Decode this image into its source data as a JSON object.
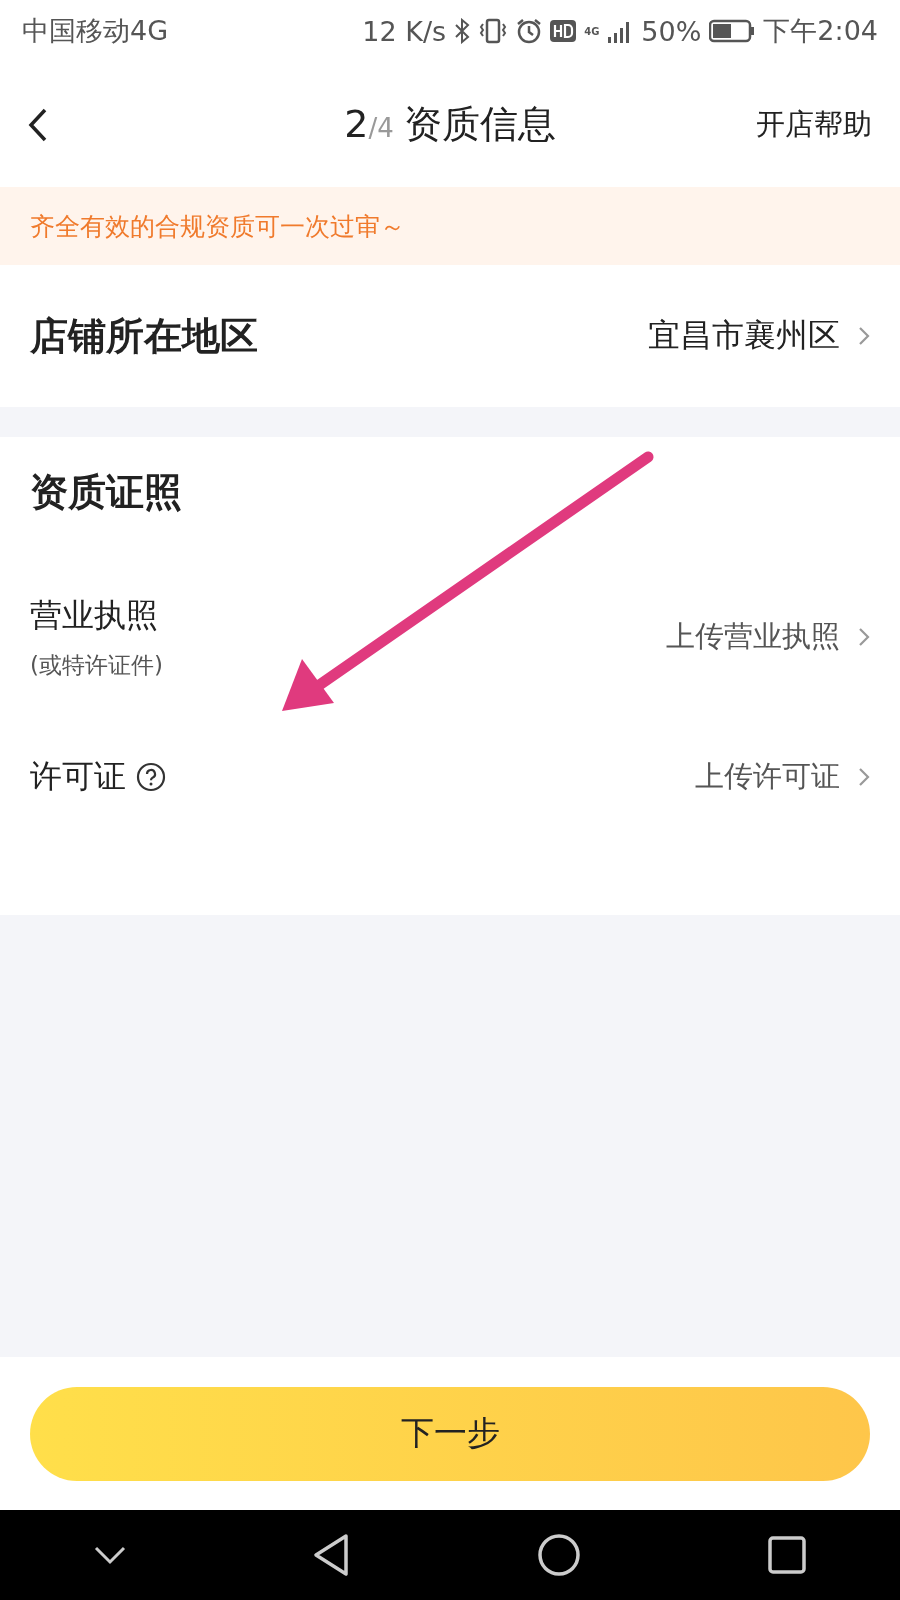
{
  "status_bar": {
    "carrier": "中国移动4G",
    "speed": "12 K/s",
    "network": "4G",
    "battery": "50%",
    "time": "下午2:04"
  },
  "header": {
    "step": "2",
    "total": "/4",
    "title": "资质信息",
    "help": "开店帮助"
  },
  "notice": "齐全有效的合规资质可一次过审～",
  "region": {
    "label": "店铺所在地区",
    "value": "宜昌市襄州区"
  },
  "licenses": {
    "title": "资质证照",
    "rows": [
      {
        "kind": "business",
        "label": "营业执照",
        "sublabel": "(或特许证件)",
        "action": "上传营业执照"
      },
      {
        "kind": "permit",
        "label": "许可证",
        "action": "上传许可证"
      }
    ]
  },
  "next_button": "下一步"
}
